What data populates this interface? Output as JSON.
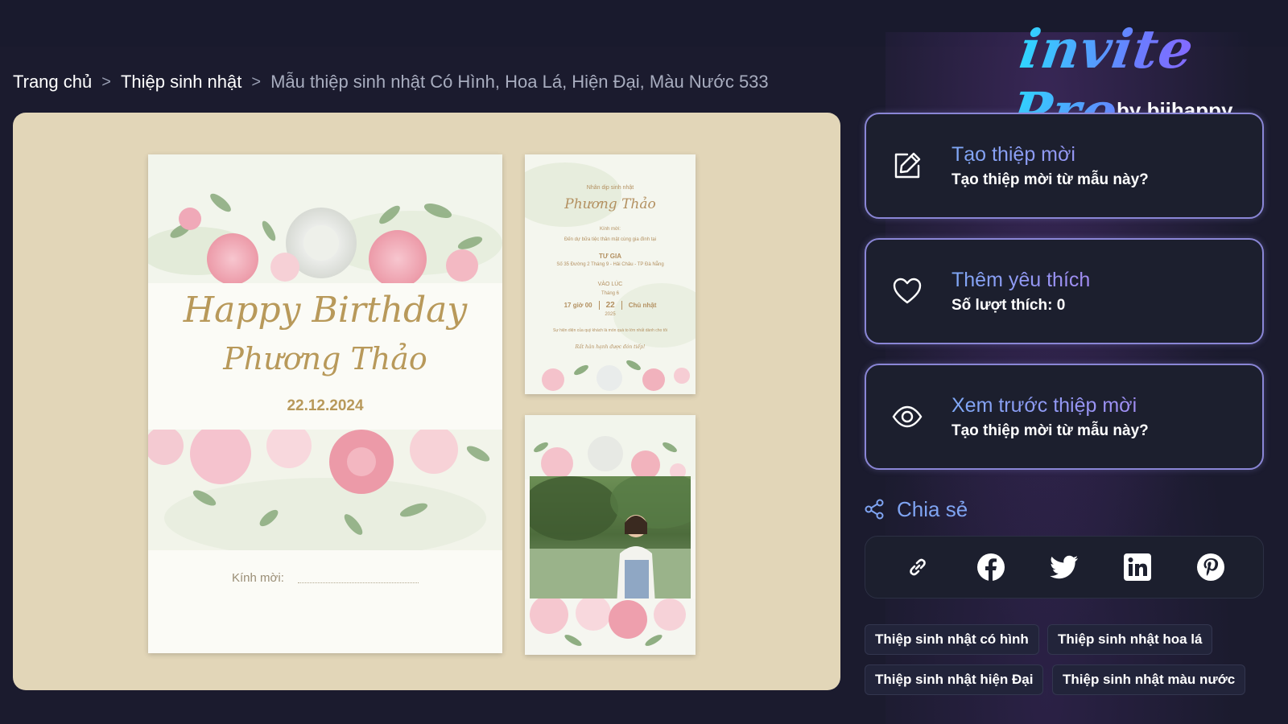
{
  "breadcrumb": {
    "home": "Trang chủ",
    "category": "Thiệp sinh nhật",
    "current": "Mẫu thiệp sinh nhật Có Hình, Hoa Lá, Hiện Đại, Màu Nước 533",
    "separator": ">"
  },
  "logo": {
    "script": "invite Pro",
    "by": "by biihappy"
  },
  "card_main": {
    "title": "Happy Birthday",
    "name": "Phương Thảo",
    "date": "22.12.2024",
    "invite_label": "Kính mời:"
  },
  "card_small": {
    "occasion": "Nhân dịp sinh nhật",
    "name": "Phương Thảo",
    "invite": "Kính mời:",
    "attend": "Đến dự bữa tiệc thân mật cùng gia đình tại",
    "venue_title": "TƯ GIA",
    "address": "Số 35 Đường 2 Tháng 9 - Hải Châu - TP Đà Nẵng",
    "time_title": "VÀO LÚC",
    "time": "17 giờ 00",
    "month": "Tháng 6",
    "day": "22",
    "year": "2025",
    "weekday": "Chủ nhật",
    "note": "Sự hiện diện của quý khách là món quà to lớn nhất dành cho tôi",
    "thanks": "Rất hân hạnh được đón tiếp!"
  },
  "actions": [
    {
      "title": "Tạo thiệp mời",
      "subtitle": "Tạo thiệp mời từ mẫu này?",
      "icon": "edit-icon"
    },
    {
      "title": "Thêm yêu thích",
      "subtitle": "Số lượt thích: 0",
      "icon": "heart-icon"
    },
    {
      "title": "Xem trước thiệp mời",
      "subtitle": "Tạo thiệp mời từ mẫu này?",
      "icon": "eye-icon"
    }
  ],
  "share": {
    "label": "Chia sẻ",
    "buttons": [
      "link-icon",
      "facebook-icon",
      "twitter-icon",
      "linkedin-icon",
      "pinterest-icon"
    ]
  },
  "tags": [
    "Thiệp sinh nhật có hình",
    "Thiệp sinh nhật hoa lá",
    "Thiệp sinh nhật hiện Đại",
    "Thiệp sinh nhật màu nước"
  ],
  "colors": {
    "background": "#1b1b2e",
    "preview_bg": "#e2d6b8",
    "card_border": "#8a86d6",
    "accent_blue": "#7fa4f2",
    "gold_text": "#b8995a"
  }
}
